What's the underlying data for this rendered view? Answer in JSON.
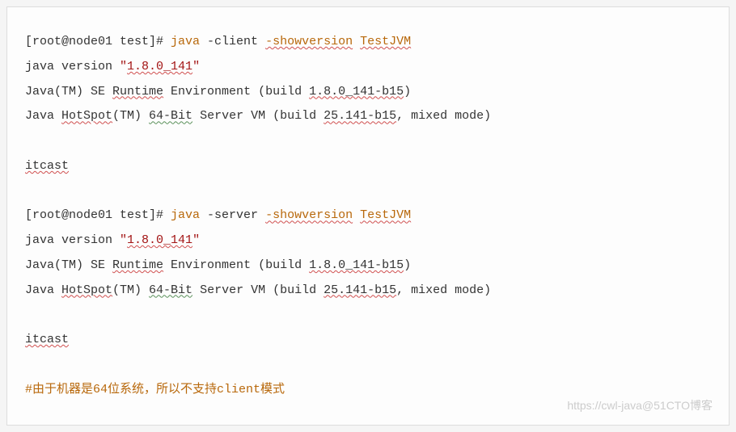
{
  "l1": {
    "prompt": "[root@node01 test]# ",
    "cmd_java": "java",
    "flag_client": " -client ",
    "flag_showver": "-showversion",
    "space": " ",
    "testjvm": "TestJVM"
  },
  "l2": {
    "pre": "java version ",
    "q1": "\"",
    "ver": "1.8.0_141",
    "q2": "\""
  },
  "l3": {
    "a": "Java(TM) SE ",
    "runtime": "Runtime",
    "b": " Environment (build ",
    "build": "1.8.0_141-b15",
    "c": ")"
  },
  "l4": {
    "a": "Java ",
    "hotspot": "HotSpot",
    "b": "(TM) ",
    "sixtyfourbit": "64-Bit",
    "c": " Server VM (build ",
    "build": "25.141-b15",
    "d": ", mixed mode)"
  },
  "l5": "itcast",
  "l6": {
    "prompt": "[root@node01 test]# ",
    "cmd_java": "java",
    "flag_server": " -server ",
    "flag_showver": "-showversion",
    "space": " ",
    "testjvm": "TestJVM"
  },
  "l7": {
    "pre": "java version ",
    "q1": "\"",
    "ver": "1.8.0_141",
    "q2": "\""
  },
  "l8": {
    "a": "Java(TM) SE ",
    "runtime": "Runtime",
    "b": " Environment (build ",
    "build": "1.8.0_141-b15",
    "c": ")"
  },
  "l9": {
    "a": "Java ",
    "hotspot": "HotSpot",
    "b": "(TM) ",
    "sixtyfourbit": "64-Bit",
    "c": " Server VM (build ",
    "build": "25.141-b15",
    "d": ", mixed mode)"
  },
  "l10": "itcast",
  "comment": "#由于机器是64位系统，所以不支持client模式",
  "watermark": "https://cwl-java@51CTO博客"
}
